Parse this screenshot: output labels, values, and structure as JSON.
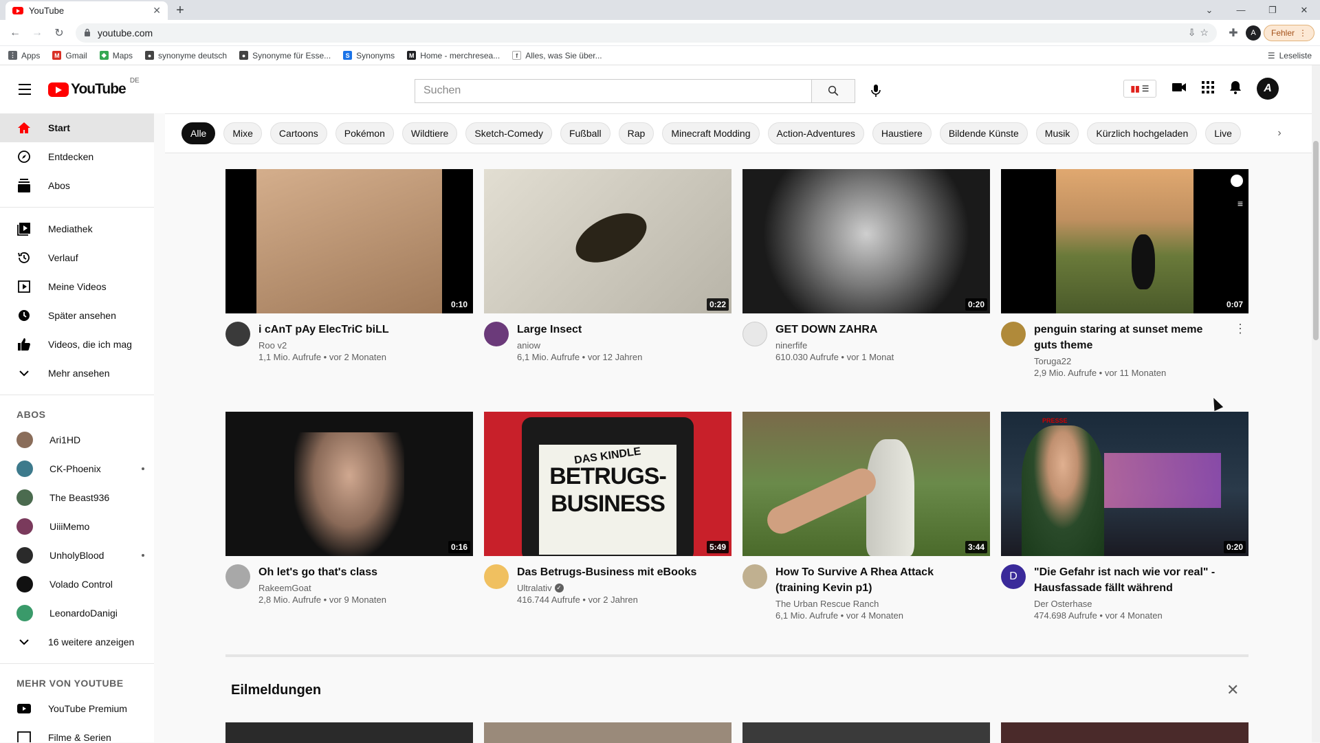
{
  "browser": {
    "tab_title": "YouTube",
    "url": "youtube.com",
    "profile_initial": "A",
    "error_label": "Fehler",
    "bookmarks": [
      {
        "label": "Apps"
      },
      {
        "label": "Gmail"
      },
      {
        "label": "Maps"
      },
      {
        "label": "synonyme deutsch"
      },
      {
        "label": "Synonyme für Esse..."
      },
      {
        "label": "Synonyms"
      },
      {
        "label": "Home - merchresea..."
      },
      {
        "label": "Alles, was Sie über..."
      }
    ],
    "reading_list": "Leseliste"
  },
  "masthead": {
    "logo_text": "YouTube",
    "country_code": "DE",
    "search_placeholder": "Suchen",
    "avatar_initial": "A"
  },
  "sidebar": {
    "main": [
      {
        "label": "Start"
      },
      {
        "label": "Entdecken"
      },
      {
        "label": "Abos"
      }
    ],
    "library": [
      {
        "label": "Mediathek"
      },
      {
        "label": "Verlauf"
      },
      {
        "label": "Meine Videos"
      },
      {
        "label": "Später ansehen"
      },
      {
        "label": "Videos, die ich mag"
      },
      {
        "label": "Mehr ansehen"
      }
    ],
    "subs_heading": "ABOS",
    "subscriptions": [
      {
        "label": "Ari1HD",
        "color": "#8a6d5a"
      },
      {
        "label": "CK-Phoenix",
        "color": "#3d7a8c"
      },
      {
        "label": "The Beast936",
        "color": "#4b6b4f"
      },
      {
        "label": "UiiiMemo",
        "color": "#7a3a5c"
      },
      {
        "label": "UnholyBlood",
        "color": "#2a2a2a"
      },
      {
        "label": "Volado Control",
        "color": "#111111"
      },
      {
        "label": "LeonardoDanigi",
        "color": "#3a9a6a"
      }
    ],
    "show_more": "16 weitere anzeigen",
    "more_heading": "MEHR VON YOUTUBE",
    "more": [
      {
        "label": "YouTube Premium"
      },
      {
        "label": "Filme & Serien"
      }
    ]
  },
  "chips": [
    "Alle",
    "Mixe",
    "Cartoons",
    "Pokémon",
    "Wildtiere",
    "Sketch-Comedy",
    "Fußball",
    "Rap",
    "Minecraft Modding",
    "Action-Adventures",
    "Haustiere",
    "Bildende Künste",
    "Musik",
    "Kürzlich hochgeladen",
    "Live"
  ],
  "videos": [
    {
      "title": "i cAnT pAy ElecTriC biLL",
      "channel": "Roo v2",
      "stats": "1,1 Mio. Aufrufe • vor 2 Monaten",
      "duration": "0:10",
      "thumb_color": "#c69c7c",
      "avatar_color": "#3a3a3a",
      "avatar_letter": ""
    },
    {
      "title": "Large Insect",
      "channel": "aniow",
      "stats": "6,1 Mio. Aufrufe • vor 12 Jahren",
      "duration": "0:22",
      "thumb_color": "#d6d2c6",
      "avatar_color": "#6b3a7a",
      "avatar_letter": ""
    },
    {
      "title": "GET DOWN ZAHRA",
      "channel": "ninerfife",
      "stats": "610.030 Aufrufe • vor 1 Monat",
      "duration": "0:20",
      "thumb_color": "#4a4a4a",
      "avatar_color": "#e8e8e8",
      "avatar_letter": ""
    },
    {
      "title": "penguin staring at sunset meme guts theme",
      "channel": "Toruga22",
      "stats": "2,9 Mio. Aufrufe • vor 11 Monaten",
      "duration": "0:07",
      "thumb_color": "#8a7a4a",
      "avatar_color": "#b08a3a",
      "avatar_letter": ""
    },
    {
      "title": "Oh let's go that's class",
      "channel": "RakeemGoat",
      "stats": "2,8 Mio. Aufrufe • vor 9 Monaten",
      "duration": "0:16",
      "thumb_color": "#2a2a2a",
      "avatar_color": "#a8a8a8",
      "avatar_letter": ""
    },
    {
      "title": "Das Betrugs-Business mit eBooks",
      "channel": "Ultralativ",
      "stats": "416.744 Aufrufe • vor 2 Jahren",
      "duration": "5:49",
      "thumb_color": "#c8202a",
      "avatar_color": "#f0c060",
      "avatar_letter": "",
      "verified": true,
      "thumb_text_1": "DAS KINDLE",
      "thumb_text_2": "BETRUGS-",
      "thumb_text_3": "BUSINESS"
    },
    {
      "title": "How To Survive A Rhea Attack (training Kevin p1)",
      "channel": "The Urban Rescue Ranch",
      "stats": "6,1 Mio. Aufrufe • vor 4 Monaten",
      "duration": "3:44",
      "thumb_color": "#6a8a4a",
      "avatar_color": "#c0b090",
      "avatar_letter": ""
    },
    {
      "title": "\"Die Gefahr ist nach wie vor real\" - Hausfassade fällt während Interview...",
      "channel": "Der Osterhase",
      "stats": "474.698 Aufrufe • vor 4 Monaten",
      "duration": "0:20",
      "thumb_color": "#1a2a3a",
      "avatar_color": "#3a2a9a",
      "avatar_letter": "D",
      "thumb_text_1": "PRESSE"
    }
  ],
  "shelf": {
    "title": "Eilmeldungen"
  },
  "colors": {
    "brand_red": "#ff0000",
    "text_secondary": "#606060"
  }
}
